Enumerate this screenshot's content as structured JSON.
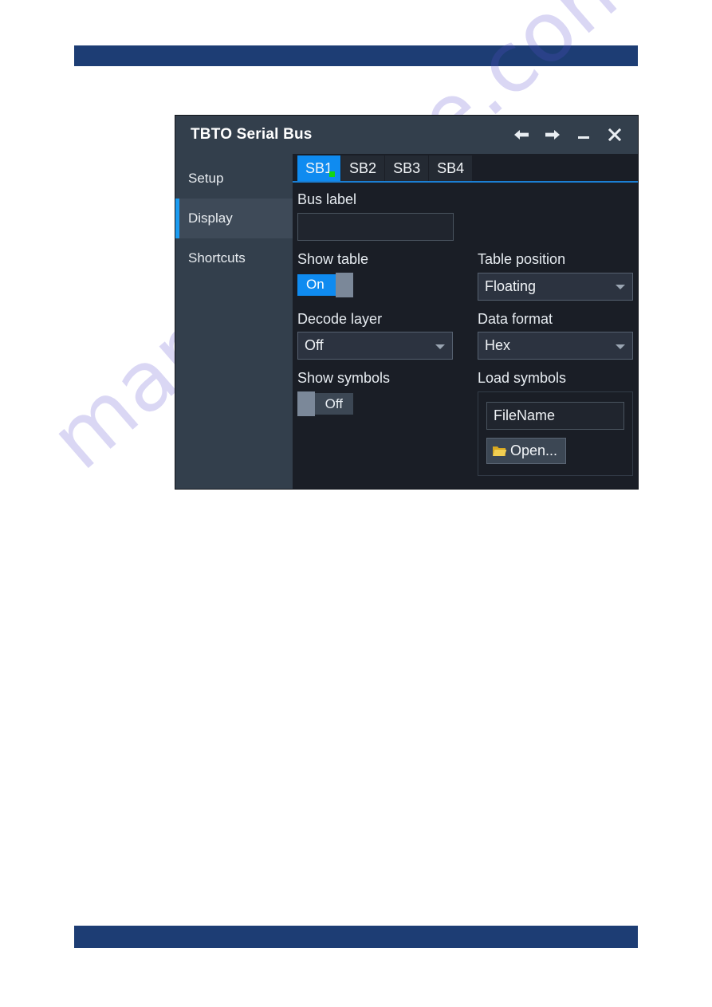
{
  "page": {
    "watermark": "manualshive.com",
    "header_rule": "",
    "footer_rule": ""
  },
  "dialog": {
    "title": "TBTO Serial Bus",
    "window_controls": [
      {
        "name": "back-arrow",
        "label": "←"
      },
      {
        "name": "forward-arrow",
        "label": "→"
      },
      {
        "name": "minimize",
        "label": "—"
      },
      {
        "name": "close",
        "label": "✕"
      }
    ],
    "sidebar": {
      "items": [
        {
          "label": "Setup",
          "active": false
        },
        {
          "label": "Display",
          "active": true
        },
        {
          "label": "Shortcuts",
          "active": false
        }
      ]
    },
    "tabs": [
      {
        "label": "SB1",
        "active": true,
        "indicator": true
      },
      {
        "label": "SB2",
        "active": false,
        "indicator": false
      },
      {
        "label": "SB3",
        "active": false,
        "indicator": false
      },
      {
        "label": "SB4",
        "active": false,
        "indicator": false
      }
    ],
    "fields": {
      "bus_label": {
        "label": "Bus label",
        "value": "",
        "placeholder": ""
      },
      "show_table": {
        "label": "Show table",
        "state": "On"
      },
      "table_position": {
        "label": "Table position",
        "value": "Floating"
      },
      "decode_layer": {
        "label": "Decode layer",
        "value": "Off"
      },
      "data_format": {
        "label": "Data format",
        "value": "Hex"
      },
      "show_symbols": {
        "label": "Show symbols",
        "state": "Off"
      },
      "load_symbols": {
        "label": "Load symbols",
        "filename": "FileName",
        "open_button": "Open..."
      }
    }
  },
  "colors": {
    "accent_blue": "#0f8bf0",
    "titlebar": "#333f4c",
    "panel_bg": "#1a1e26",
    "rule_blue": "#1d3d74",
    "indicator_green": "#13d613",
    "folder_yellow": "#e8c13a"
  }
}
